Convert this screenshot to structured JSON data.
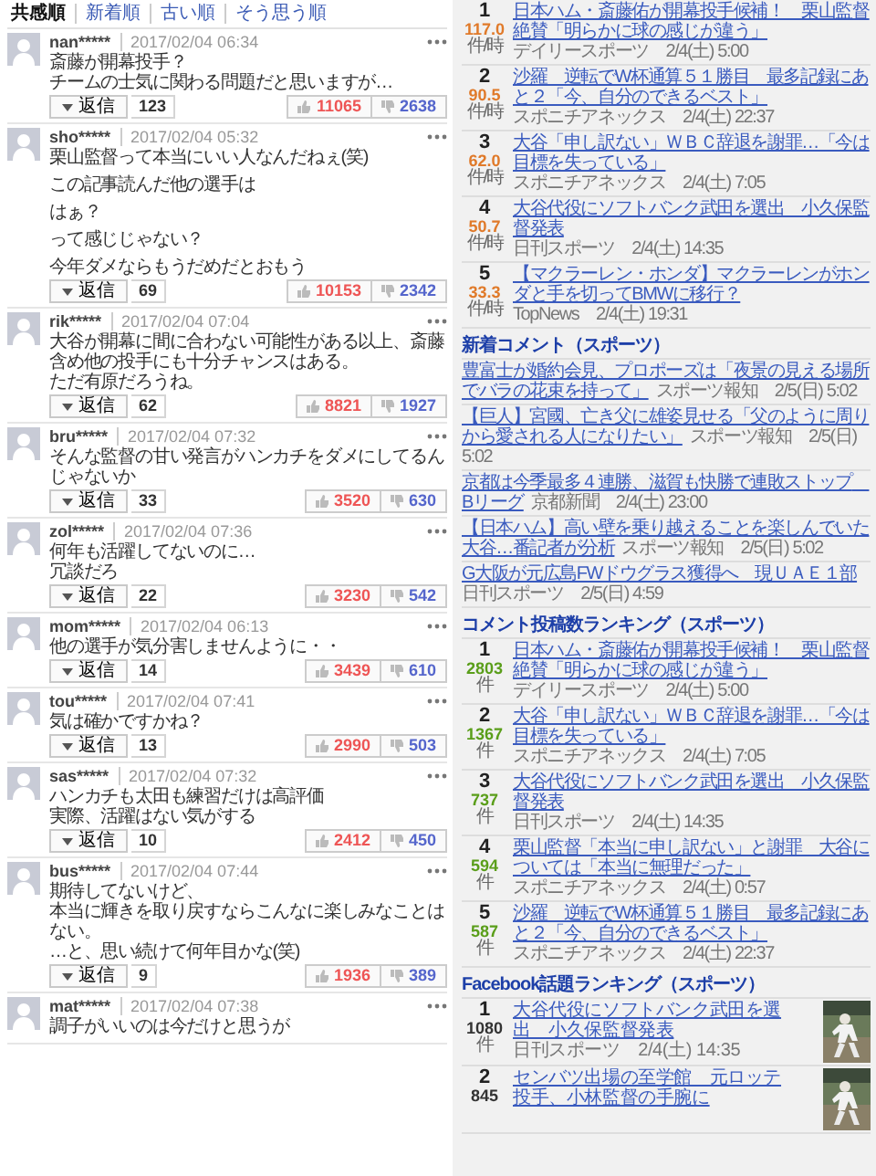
{
  "sort_tabs": [
    {
      "label": "共感順",
      "selected": true
    },
    {
      "label": "新着順",
      "selected": false
    },
    {
      "label": "古い順",
      "selected": false
    },
    {
      "label": "そう思う順",
      "selected": false
    }
  ],
  "comments": [
    {
      "user": "nan*****",
      "time": "2017/02/04 06:34",
      "paragraphs": [
        [
          "斎藤が開幕投手？",
          "チームの士気に関わる問題だと思いますが…"
        ]
      ],
      "reply_label": "返信",
      "replies": "123",
      "likes": "11065",
      "dislikes": "2638"
    },
    {
      "user": "sho*****",
      "time": "2017/02/04 05:32",
      "paragraphs": [
        [
          "栗山監督って本当にいい人なんだねぇ(笑)"
        ],
        [
          "この記事読んだ他の選手は"
        ],
        [
          "はぁ？"
        ],
        [
          "って感じじゃない？"
        ],
        [
          "今年ダメならもうだめだとおもう"
        ]
      ],
      "reply_label": "返信",
      "replies": "69",
      "likes": "10153",
      "dislikes": "2342"
    },
    {
      "user": "rik*****",
      "time": "2017/02/04 07:04",
      "paragraphs": [
        [
          "大谷が開幕に間に合わない可能性がある以上、斎藤含め他の投手にも十分チャンスはある。",
          "ただ有原だろうね。"
        ]
      ],
      "reply_label": "返信",
      "replies": "62",
      "likes": "8821",
      "dislikes": "1927"
    },
    {
      "user": "bru*****",
      "time": "2017/02/04 07:32",
      "paragraphs": [
        [
          "そんな監督の甘い発言がハンカチをダメにしてるんじゃないか"
        ]
      ],
      "reply_label": "返信",
      "replies": "33",
      "likes": "3520",
      "dislikes": "630"
    },
    {
      "user": "zol*****",
      "time": "2017/02/04 07:36",
      "paragraphs": [
        [
          "何年も活躍してないのに…",
          "冗談だろ"
        ]
      ],
      "reply_label": "返信",
      "replies": "22",
      "likes": "3230",
      "dislikes": "542"
    },
    {
      "user": "mom*****",
      "time": "2017/02/04 06:13",
      "paragraphs": [
        [
          "他の選手が気分害しませんように・・"
        ]
      ],
      "reply_label": "返信",
      "replies": "14",
      "likes": "3439",
      "dislikes": "610"
    },
    {
      "user": "tou*****",
      "time": "2017/02/04 07:41",
      "paragraphs": [
        [
          "気は確かですかね？"
        ]
      ],
      "reply_label": "返信",
      "replies": "13",
      "likes": "2990",
      "dislikes": "503"
    },
    {
      "user": "sas*****",
      "time": "2017/02/04 07:32",
      "paragraphs": [
        [
          "ハンカチも太田も練習だけは高評価",
          "実際、活躍はない気がする"
        ]
      ],
      "reply_label": "返信",
      "replies": "10",
      "likes": "2412",
      "dislikes": "450"
    },
    {
      "user": "bus*****",
      "time": "2017/02/04 07:44",
      "paragraphs": [
        [
          "期待してないけど、",
          "本当に輝きを取り戻すならこんなに楽しみなことはない。",
          "…と、思い続けて何年目かな(笑)"
        ]
      ],
      "reply_label": "返信",
      "replies": "9",
      "likes": "1936",
      "dislikes": "389"
    },
    {
      "user": "mat*****",
      "time": "2017/02/04 07:38",
      "paragraphs": [
        [
          "調子がいいのは今だけと思うが"
        ]
      ]
    }
  ],
  "sidebar": [
    {
      "kind": "ranking",
      "color": "#e07a2a",
      "items": [
        {
          "rank": "1",
          "score": "117.0",
          "unit": "件/時",
          "title": "日本ハム・斎藤佑が開幕投手候補！　栗山監督絶賛「明らかに球の感じが違う」",
          "source": "デイリースポーツ　2/4(土) 5:00"
        },
        {
          "rank": "2",
          "score": "90.5",
          "unit": "件/時",
          "title": "沙羅　逆転でW杯通算５１勝目　最多記録にあと２「今、自分のできるベスト」",
          "source": "スポニチアネックス　2/4(土) 22:37"
        },
        {
          "rank": "3",
          "score": "62.0",
          "unit": "件/時",
          "title": "大谷「申し訳ない」ＷＢＣ辞退を謝罪…「今は目標を失っている」",
          "source": "スポニチアネックス　2/4(土) 7:05"
        },
        {
          "rank": "4",
          "score": "50.7",
          "unit": "件/時",
          "title": "大谷代役にソフトバンク武田を選出　小久保監督発表",
          "source": "日刊スポーツ　2/4(土) 14:35"
        },
        {
          "rank": "5",
          "score": "33.3",
          "unit": "件/時",
          "title": "【マクラーレン・ホンダ】マクラーレンがホンダと手を切ってBMWに移行？",
          "source": "TopNews　2/4(土) 19:31"
        }
      ]
    },
    {
      "kind": "list",
      "title": "新着コメント（スポーツ）",
      "items": [
        {
          "title": "豊富士が婚約会見、プロポーズは「夜景の見える場所でバラの花束を持って」",
          "source": "スポーツ報知　2/5(日) 5:02"
        },
        {
          "title": "【巨人】宮國、亡き父に雄姿見せる「父のように周りから愛される人になりたい」",
          "source": "スポーツ報知　2/5(日) 5:02"
        },
        {
          "title": "京都は今季最多４連勝、滋賀も快勝で連敗ストップ　Bリーグ",
          "source": "京都新聞　2/4(土) 23:00"
        },
        {
          "title": "【日本ハム】高い壁を乗り越えることを楽しんでいた大谷…番記者が分析",
          "source": "スポーツ報知　2/5(日) 5:02"
        },
        {
          "title": "G大阪が元広島FWドウグラス獲得へ　現ＵＡＥ１部",
          "source": "日刊スポーツ　2/5(日) 4:59"
        }
      ]
    },
    {
      "kind": "ranking",
      "title": "コメント投稿数ランキング（スポーツ）",
      "color": "#5a9e1a",
      "items": [
        {
          "rank": "1",
          "score": "2803",
          "unit": "件",
          "title": "日本ハム・斎藤佑が開幕投手候補！　栗山監督絶賛「明らかに球の感じが違う」",
          "source": "デイリースポーツ　2/4(土) 5:00"
        },
        {
          "rank": "2",
          "score": "1367",
          "unit": "件",
          "title": "大谷「申し訳ない」ＷＢＣ辞退を謝罪…「今は目標を失っている」",
          "source": "スポニチアネックス　2/4(土) 7:05"
        },
        {
          "rank": "3",
          "score": "737",
          "unit": "件",
          "title": "大谷代役にソフトバンク武田を選出　小久保監督発表",
          "source": "日刊スポーツ　2/4(土) 14:35"
        },
        {
          "rank": "4",
          "score": "594",
          "unit": "件",
          "title": "栗山監督「本当に申し訳ない」と謝罪　大谷については「本当に無理だった」",
          "source": "スポニチアネックス　2/4(土) 0:57"
        },
        {
          "rank": "5",
          "score": "587",
          "unit": "件",
          "title": "沙羅　逆転でW杯通算５１勝目　最多記録にあと２「今、自分のできるベスト」",
          "source": "スポニチアネックス　2/4(土) 22:37"
        }
      ]
    },
    {
      "kind": "thumb_ranking",
      "title": "Facebook話題ランキング（スポーツ）",
      "color": "#333333",
      "items": [
        {
          "rank": "1",
          "score": "1080",
          "unit": "件",
          "title": "大谷代役にソフトバンク武田を選出　小久保監督発表",
          "source": "日刊スポーツ　2/4(土) 14:35"
        },
        {
          "rank": "2",
          "score": "845",
          "title": "センバツ出場の至学館　元ロッテ投手、小林監督の手腕に"
        }
      ]
    }
  ]
}
